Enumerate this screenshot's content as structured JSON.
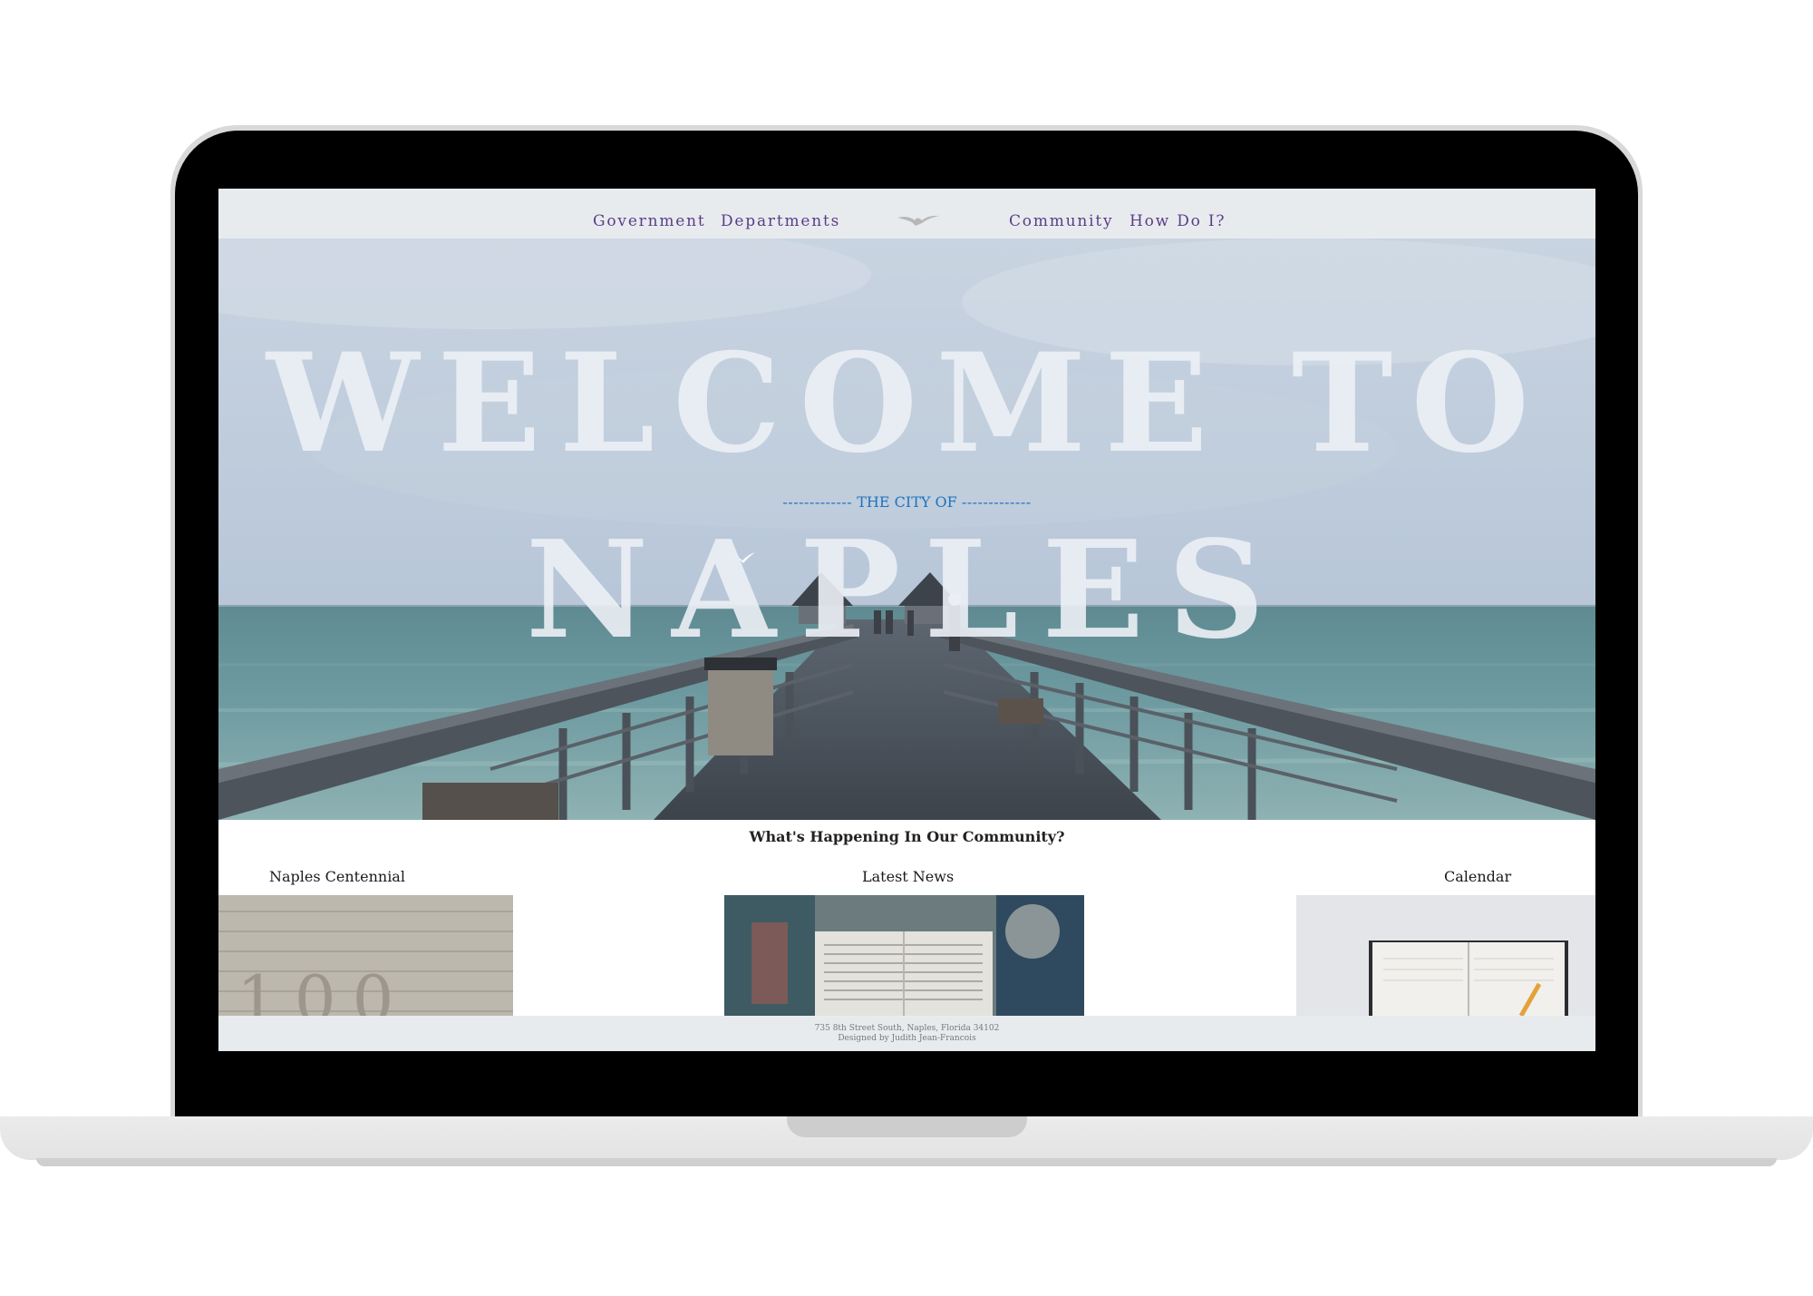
{
  "nav": {
    "items": [
      "Government",
      "Departments",
      "Community",
      "How Do I?"
    ],
    "logo_icon": "seagull-icon"
  },
  "hero": {
    "title_line1": "WELCOME TO",
    "subtitle_dashes_left": "-------------",
    "subtitle": "THE CITY OF",
    "subtitle_dashes_right": "-------------",
    "title_line2": "NAPLES"
  },
  "section": {
    "heading": "What's Happening In Our Community?"
  },
  "cards": [
    {
      "title": "Naples Centennial",
      "image": "centennial-wall-photo"
    },
    {
      "title": "Latest News",
      "image": "newspaper-photo"
    },
    {
      "title": "Calendar",
      "image": "planner-photo"
    }
  ],
  "footer": {
    "address": "735 8th Street South, Naples, Florida 34102",
    "credit": "Designed by Judith Jean-Francois"
  },
  "colors": {
    "nav_bg": "#e8ebee",
    "nav_link": "#5b3d87",
    "subtitle_blue": "#1e73be",
    "laptop_bezel": "#000000"
  }
}
